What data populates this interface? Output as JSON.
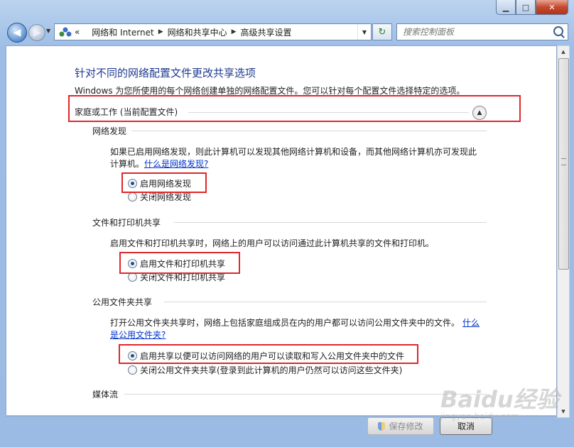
{
  "window": {
    "minimize": "▁",
    "maximize": "□",
    "close": "✕"
  },
  "address": {
    "prefix": "«",
    "crumbs": [
      "网络和 Internet",
      "网络和共享中心",
      "高级共享设置"
    ]
  },
  "search": {
    "placeholder": "搜索控制面板"
  },
  "page": {
    "title": "针对不同的网络配置文件更改共享选项",
    "description": "Windows 为您所使用的每个网络创建单独的网络配置文件。您可以针对每个配置文件选择特定的选项。",
    "profile": "家庭或工作 (当前配置文件)"
  },
  "sections": {
    "discovery": {
      "title": "网络发现",
      "text1": "如果已启用网络发现，则此计算机可以发现其他网络计算机和设备，而其他网络计算机亦可发现此",
      "text2": "计算机。",
      "link": "什么是网络发现?",
      "on": "启用网络发现",
      "off": "关闭网络发现",
      "selected": "on"
    },
    "fileprint": {
      "title": "文件和打印机共享",
      "text": "启用文件和打印机共享时，网络上的用户可以访问通过此计算机共享的文件和打印机。",
      "on": "启用文件和打印机共享",
      "off": "关闭文件和打印机共享",
      "selected": "on"
    },
    "publicfolder": {
      "title": "公用文件夹共享",
      "text1": "打开公用文件夹共享时，网络上包括家庭组成员在内的用户都可以访问公用文件夹中的文件。",
      "link1": "什么",
      "link2": "是公用文件夹?",
      "on": "启用共享以便可以访问网络的用户可以读取和写入公用文件夹中的文件",
      "off": "关闭公用文件夹共享(登录到此计算机的用户仍然可以访问这些文件夹)",
      "selected": "on"
    },
    "media": {
      "title": "媒体流"
    }
  },
  "buttons": {
    "save": "保存修改",
    "cancel": "取消"
  },
  "watermark": {
    "main": "Baidu经验",
    "sub": "jingyan.baidu.com"
  },
  "colors": {
    "title": "#1e3a8f",
    "link": "#0033cc",
    "highlight": "#e0262b"
  }
}
